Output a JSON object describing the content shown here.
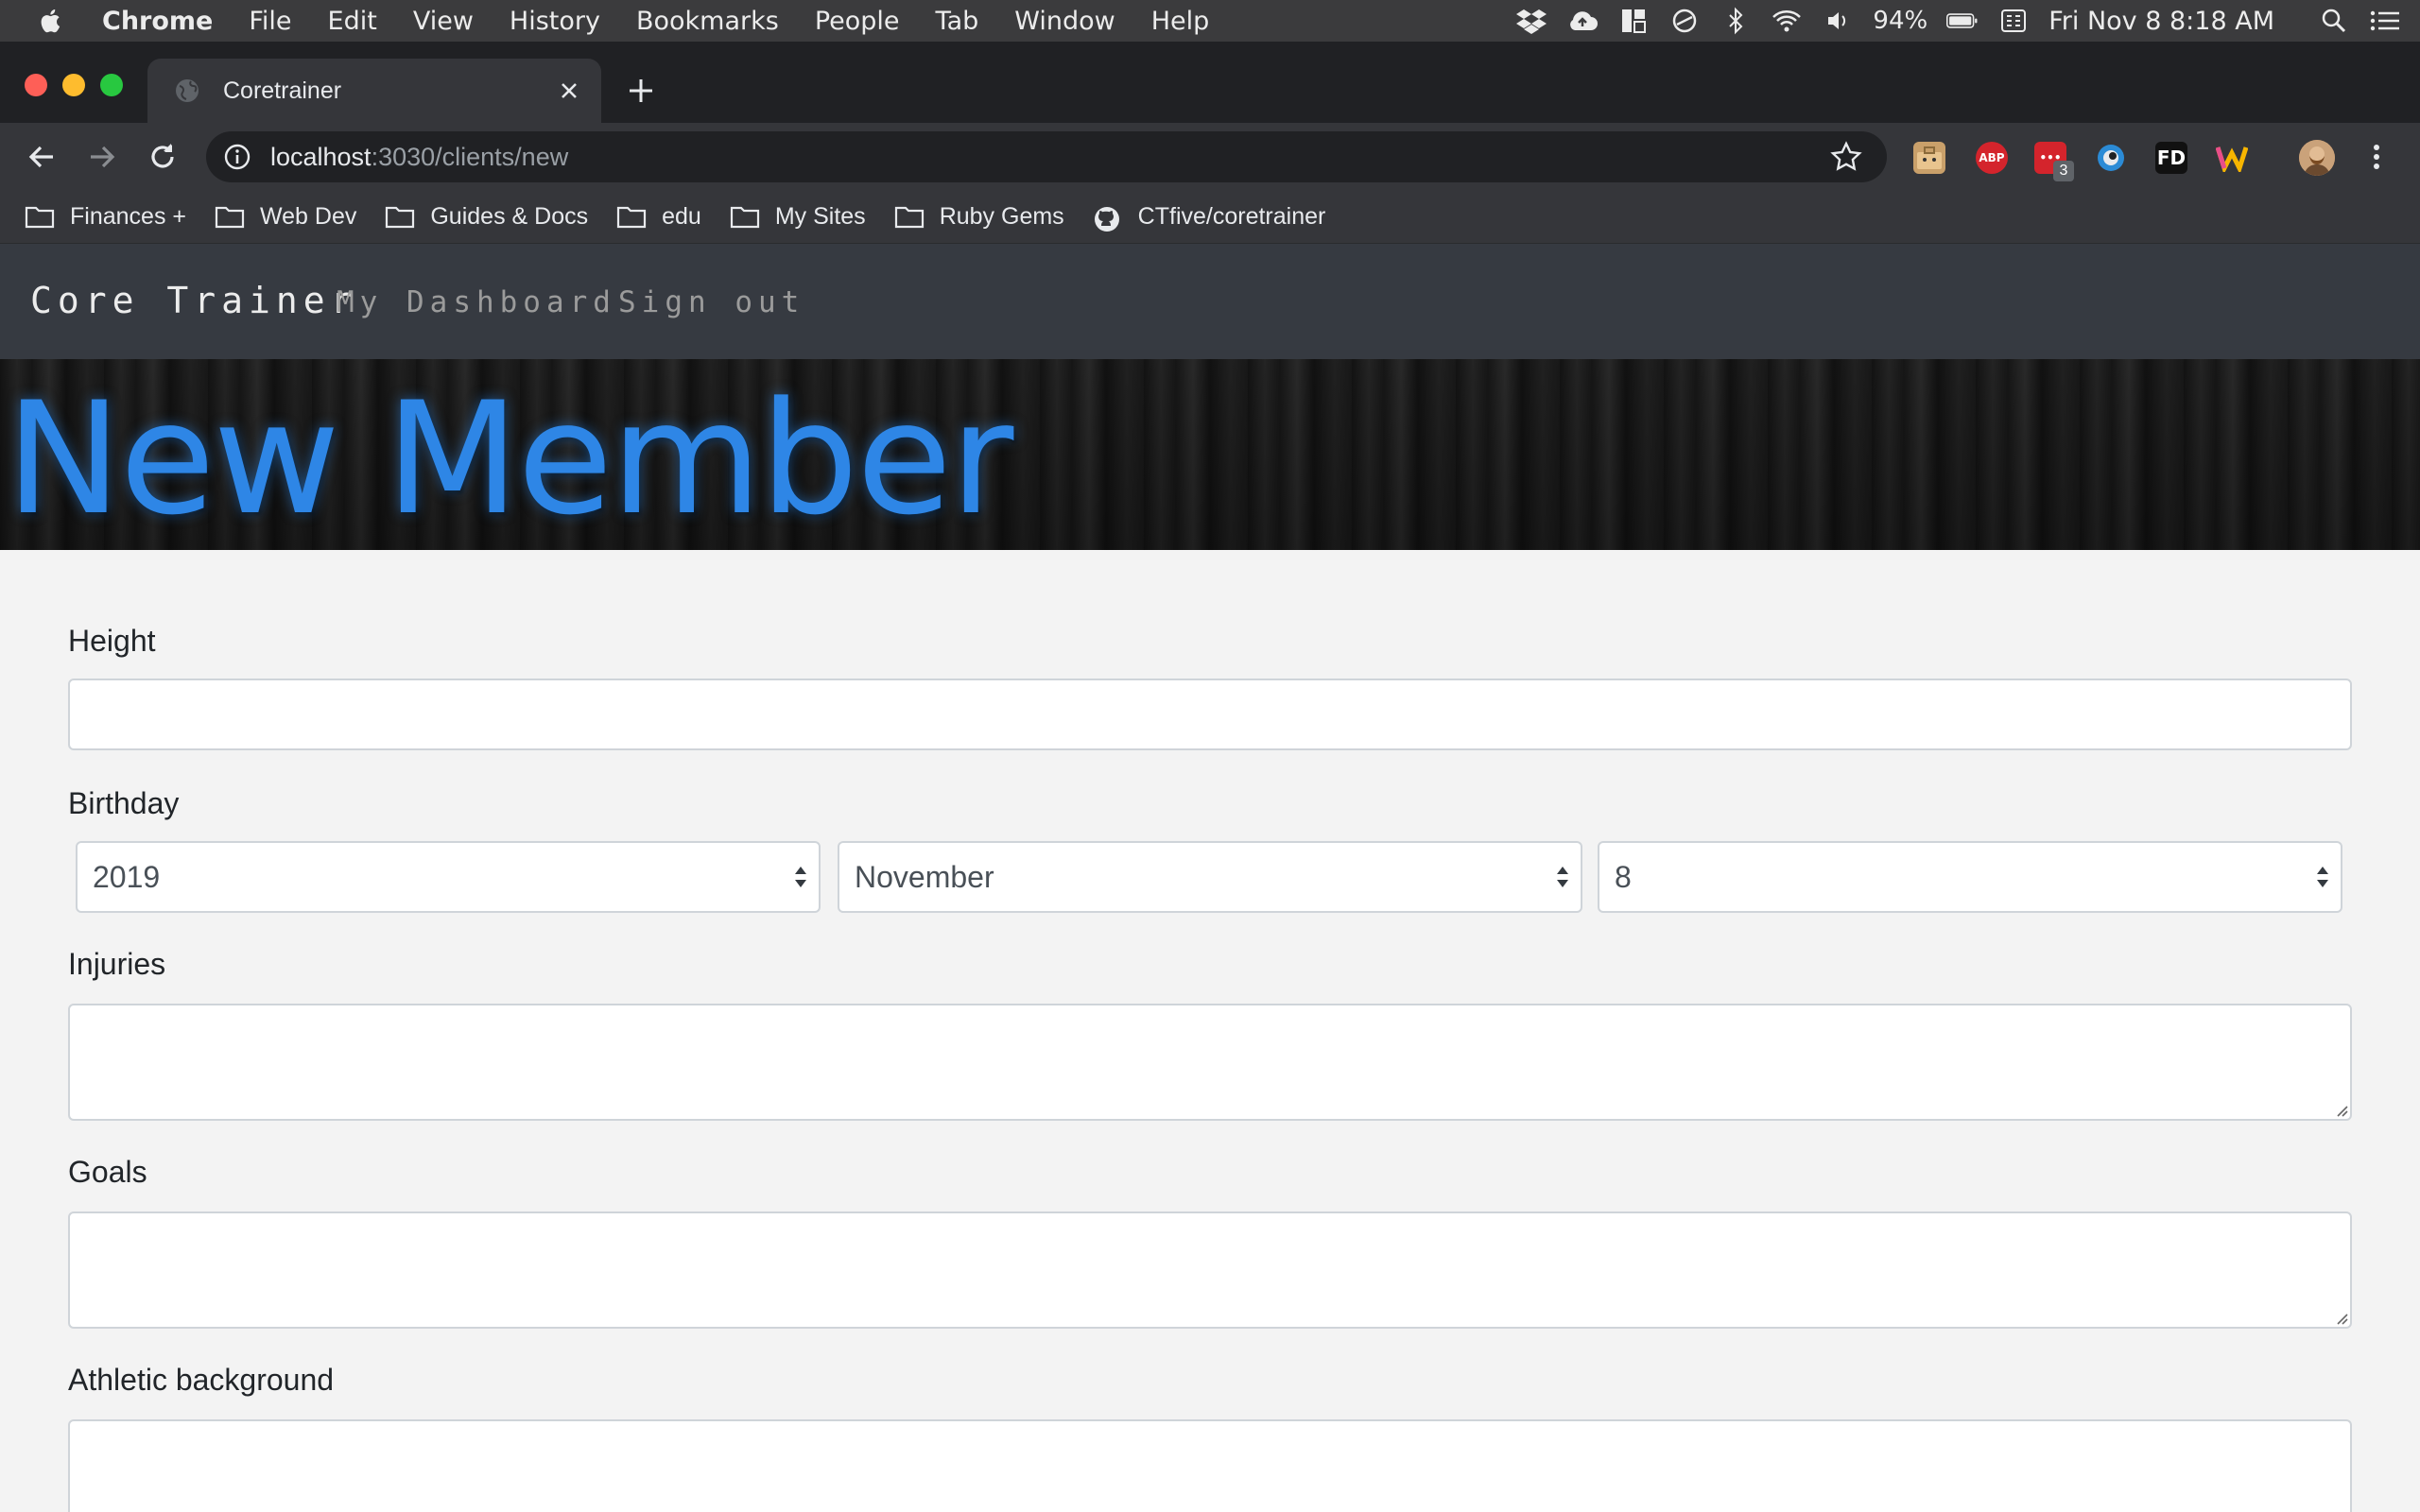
{
  "menubar": {
    "app_name": "Chrome",
    "menus": [
      "File",
      "Edit",
      "View",
      "History",
      "Bookmarks",
      "People",
      "Tab",
      "Window",
      "Help"
    ],
    "battery": "94%",
    "clock": "Fri Nov 8  8:18 AM"
  },
  "browser": {
    "tab_title": "Coretrainer",
    "url_host": "localhost",
    "url_rest": ":3030/clients/new",
    "extension_badge": "3",
    "bookmarks": [
      "Finances +",
      "Web Dev",
      "Guides & Docs",
      "edu",
      "My Sites",
      "Ruby Gems",
      "CTfive/coretrainer"
    ]
  },
  "site": {
    "brand": "Core Trainer",
    "nav": {
      "dashboard": "My Dashboard",
      "signout": "Sign out"
    },
    "heading": "New Member",
    "accent_color": "#2e86e6"
  },
  "form": {
    "height_label": "Height",
    "height_value": "",
    "birthday_label": "Birthday",
    "birthday_year": "2019",
    "birthday_month": "November",
    "birthday_day": "8",
    "injuries_label": "Injuries",
    "goals_label": "Goals",
    "athletic_label": "Athletic background"
  }
}
